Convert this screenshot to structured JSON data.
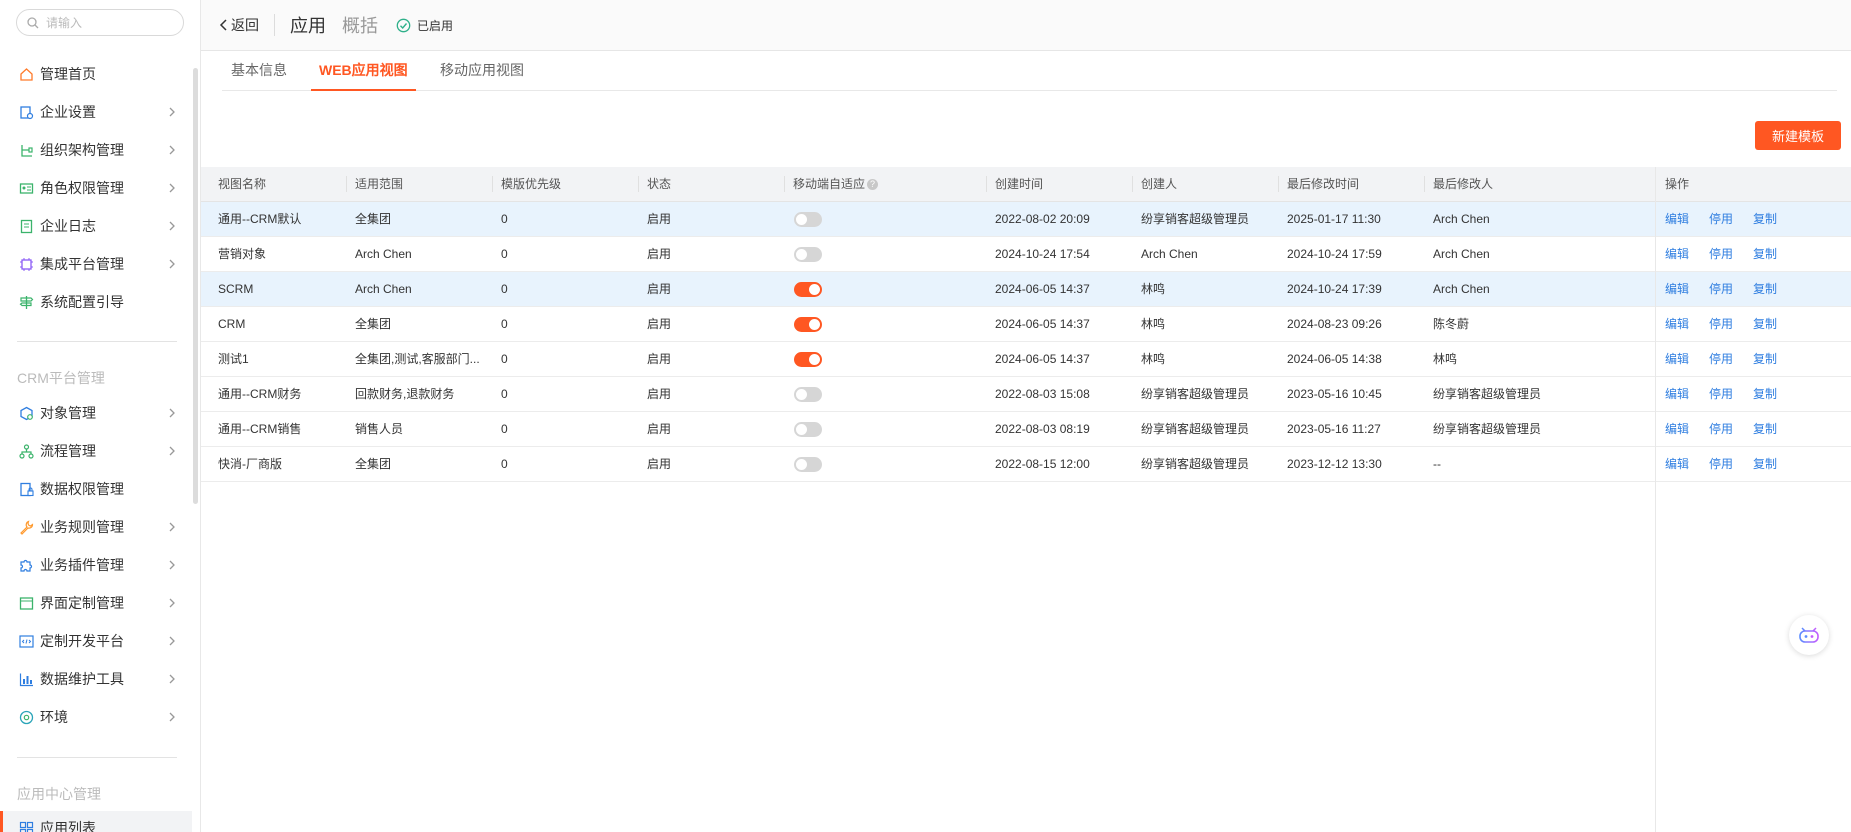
{
  "search": {
    "placeholder": "请输入"
  },
  "sidebar": {
    "items": [
      {
        "label": "管理首页"
      },
      {
        "label": "企业设置"
      },
      {
        "label": "组织架构管理"
      },
      {
        "label": "角色权限管理"
      },
      {
        "label": "企业日志"
      },
      {
        "label": "集成平台管理"
      },
      {
        "label": "系统配置引导"
      }
    ],
    "section_crm": "CRM平台管理",
    "crm_items": [
      {
        "label": "对象管理"
      },
      {
        "label": "流程管理"
      },
      {
        "label": "数据权限管理"
      },
      {
        "label": "业务规则管理"
      },
      {
        "label": "业务插件管理"
      },
      {
        "label": "界面定制管理"
      },
      {
        "label": "定制开发平台"
      },
      {
        "label": "数据维护工具"
      },
      {
        "label": "环境"
      }
    ],
    "section_app": "应用中心管理",
    "app_items": [
      {
        "label": "应用列表"
      }
    ]
  },
  "topbar": {
    "back_label": "返回",
    "title": "应用",
    "subtitle": "概括",
    "status": "已启用"
  },
  "tabs": [
    {
      "label": "基本信息"
    },
    {
      "label": "WEB应用视图"
    },
    {
      "label": "移动应用视图"
    }
  ],
  "new_button": "新建模板",
  "table": {
    "headers": [
      "视图名称",
      "适用范围",
      "模版优先级",
      "状态",
      "移动端自适应",
      "创建时间",
      "创建人",
      "最后修改时间",
      "最后修改人",
      "操作"
    ],
    "help_mark": "?",
    "actions": [
      "编辑",
      "停用",
      "复制"
    ],
    "rows": [
      {
        "name": "通用--CRM默认",
        "scope": "全集团",
        "priority": "0",
        "status": "启用",
        "mobile": false,
        "created": "2022-08-02 20:09",
        "creator": "纷享销客超级管理员",
        "modified": "2025-01-17 11:30",
        "modifier": "Arch Chen"
      },
      {
        "name": "营销对象",
        "scope": "Arch Chen",
        "priority": "0",
        "status": "启用",
        "mobile": false,
        "created": "2024-10-24 17:54",
        "creator": "Arch Chen",
        "modified": "2024-10-24 17:59",
        "modifier": "Arch Chen"
      },
      {
        "name": "SCRM",
        "scope": "Arch Chen",
        "priority": "0",
        "status": "启用",
        "mobile": true,
        "created": "2024-06-05 14:37",
        "creator": "林鸣",
        "modified": "2024-10-24 17:39",
        "modifier": "Arch Chen"
      },
      {
        "name": "CRM",
        "scope": "全集团",
        "priority": "0",
        "status": "启用",
        "mobile": true,
        "created": "2024-06-05 14:37",
        "creator": "林鸣",
        "modified": "2024-08-23 09:26",
        "modifier": "陈冬蔚"
      },
      {
        "name": "测试1",
        "scope": "全集团,测试,客服部门...",
        "priority": "0",
        "status": "启用",
        "mobile": true,
        "created": "2024-06-05 14:37",
        "creator": "林鸣",
        "modified": "2024-06-05 14:38",
        "modifier": "林鸣"
      },
      {
        "name": "通用--CRM财务",
        "scope": "回款财务,退款财务",
        "priority": "0",
        "status": "启用",
        "mobile": false,
        "created": "2022-08-03 15:08",
        "creator": "纷享销客超级管理员",
        "modified": "2023-05-16 10:45",
        "modifier": "纷享销客超级管理员"
      },
      {
        "name": "通用--CRM销售",
        "scope": "销售人员",
        "priority": "0",
        "status": "启用",
        "mobile": false,
        "created": "2022-08-03 08:19",
        "creator": "纷享销客超级管理员",
        "modified": "2023-05-16 11:27",
        "modifier": "纷享销客超级管理员"
      },
      {
        "name": "快消-厂商版",
        "scope": "全集团",
        "priority": "0",
        "status": "启用",
        "mobile": false,
        "created": "2022-08-15 12:00",
        "creator": "纷享销客超级管理员",
        "modified": "2023-12-12 13:30",
        "modifier": "--"
      }
    ]
  },
  "colors": {
    "accent": "#ff5722",
    "link": "#2f7ee0",
    "highlight_row": "#e8f3fd"
  }
}
